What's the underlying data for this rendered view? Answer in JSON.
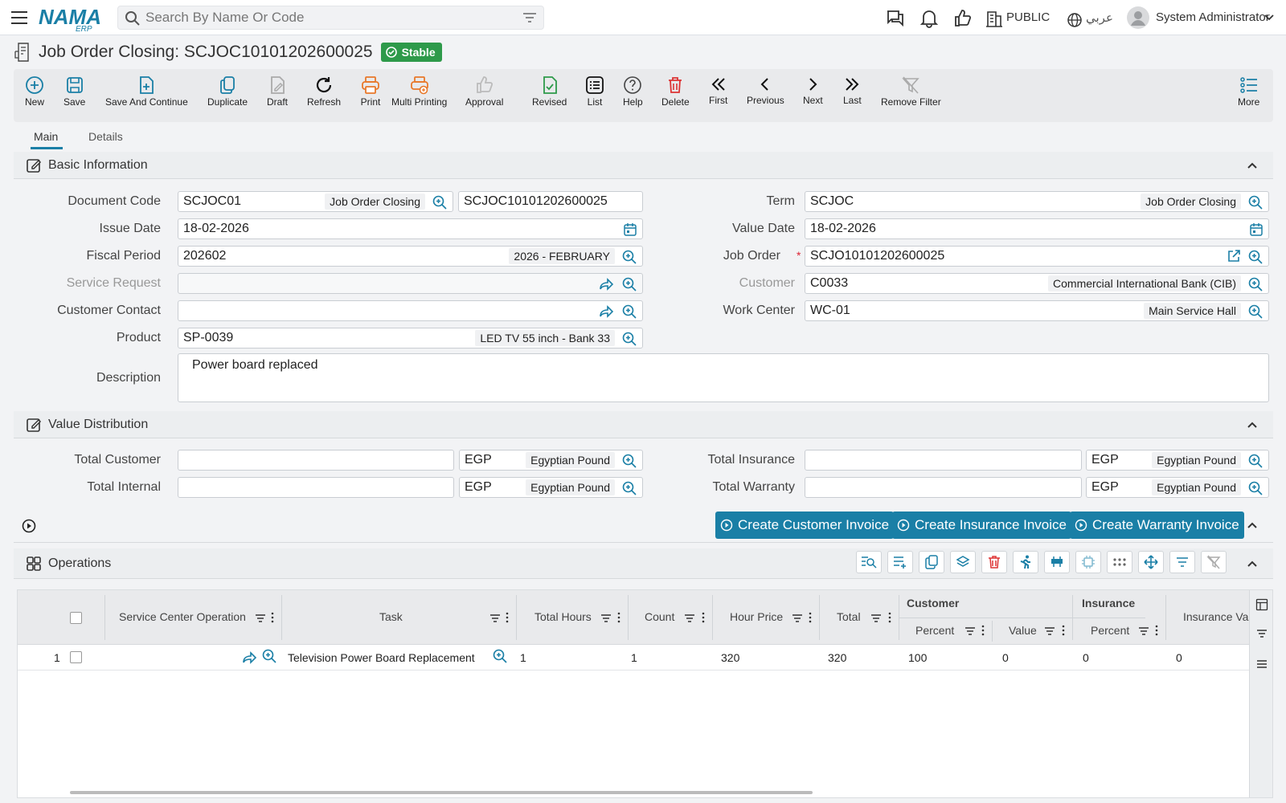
{
  "topbar": {
    "search_placeholder": "Search By Name Or Code",
    "public_label": "PUBLIC",
    "language_label": "عربي",
    "user_name": "System Administrator",
    "logo_text": "NAMA",
    "logo_sub": "ERP"
  },
  "page": {
    "title": "Job Order Closing: SCJOC10101202600025",
    "status": "Stable"
  },
  "toolbar": [
    {
      "label": "New",
      "icon": "plus-circle-icon"
    },
    {
      "label": "Save",
      "icon": "save-icon"
    },
    {
      "label": "Save And Continue",
      "icon": "save-continue-icon"
    },
    {
      "label": "Duplicate",
      "icon": "duplicate-icon"
    },
    {
      "label": "Draft",
      "icon": "draft-icon"
    },
    {
      "label": "Refresh",
      "icon": "refresh-icon"
    },
    {
      "label": "Print",
      "icon": "print-icon"
    },
    {
      "label": "Multi Printing",
      "icon": "multi-print-icon"
    },
    {
      "label": "Approval",
      "icon": "thumbs-up-icon"
    },
    {
      "label": "Revised",
      "icon": "revised-icon"
    },
    {
      "label": "List",
      "icon": "list-icon"
    },
    {
      "label": "Help",
      "icon": "help-icon"
    },
    {
      "label": "Delete",
      "icon": "trash-icon"
    },
    {
      "label": "First",
      "icon": "double-chevron-left-icon"
    },
    {
      "label": "Previous",
      "icon": "chevron-left-icon"
    },
    {
      "label": "Next",
      "icon": "chevron-right-icon"
    },
    {
      "label": "Last",
      "icon": "double-chevron-right-icon"
    },
    {
      "label": "Remove Filter",
      "icon": "remove-filter-icon"
    },
    {
      "label": "More",
      "icon": "more-list-icon"
    }
  ],
  "tabs": {
    "main": "Main",
    "details": "Details"
  },
  "basic": {
    "header": "Basic Information",
    "document_code_label": "Document Code",
    "document_code": "SCJOC01",
    "document_code_tag": "Job Order Closing",
    "document_number": "SCJOC10101202600025",
    "term_label": "Term",
    "term": "SCJOC",
    "term_tag": "Job Order Closing",
    "issue_date_label": "Issue Date",
    "issue_date": "18-02-2026",
    "value_date_label": "Value Date",
    "value_date": "18-02-2026",
    "fiscal_period_label": "Fiscal Period",
    "fiscal_period": "202602",
    "fiscal_period_tag": "2026 - FEBRUARY",
    "job_order_label": "Job Order",
    "job_order_required": "*",
    "job_order": "SCJO10101202600025",
    "service_request_label": "Service Request",
    "customer_label": "Customer",
    "customer": "C0033",
    "customer_tag": "Commercial International Bank (CIB)",
    "customer_contact_label": "Customer Contact",
    "work_center_label": "Work Center",
    "work_center": "WC-01",
    "work_center_tag": "Main Service Hall",
    "product_label": "Product",
    "product": "SP-0039",
    "product_tag": "LED TV 55 inch - Bank 33",
    "description_label": "Description",
    "description": "Power board replaced"
  },
  "value_distribution": {
    "header": "Value Distribution",
    "total_customer_label": "Total Customer",
    "total_insurance_label": "Total Insurance",
    "total_internal_label": "Total Internal",
    "total_warranty_label": "Total Warranty",
    "currency_code": "EGP",
    "currency_name": "Egyptian Pound"
  },
  "actions": {
    "create_customer_invoice": "Create Customer Invoice",
    "create_insurance_invoice": "Create Insurance Invoice",
    "create_warranty_invoice": "Create Warranty Invoice"
  },
  "operations": {
    "header": "Operations",
    "columns": {
      "service_center_operation": "Service Center Operation",
      "task": "Task",
      "total_hours": "Total Hours",
      "count": "Count",
      "hour_price": "Hour Price",
      "total": "Total",
      "customer_group": "Customer",
      "insurance_group": "Insurance",
      "percent": "Percent",
      "value": "Value",
      "insurance_value": "Insurance Val"
    },
    "rows": [
      {
        "index": "1",
        "task": "Television Power Board Replacement",
        "total_hours": "1",
        "count": "1",
        "hour_price": "320",
        "total": "320",
        "customer_percent": "100",
        "customer_value": "0",
        "insurance_percent": "0",
        "insurance_value": "0"
      }
    ]
  },
  "colors": {
    "accent": "#1a7fa6",
    "stable": "#2e9a4a",
    "danger": "#d33",
    "print": "#e8782a"
  }
}
